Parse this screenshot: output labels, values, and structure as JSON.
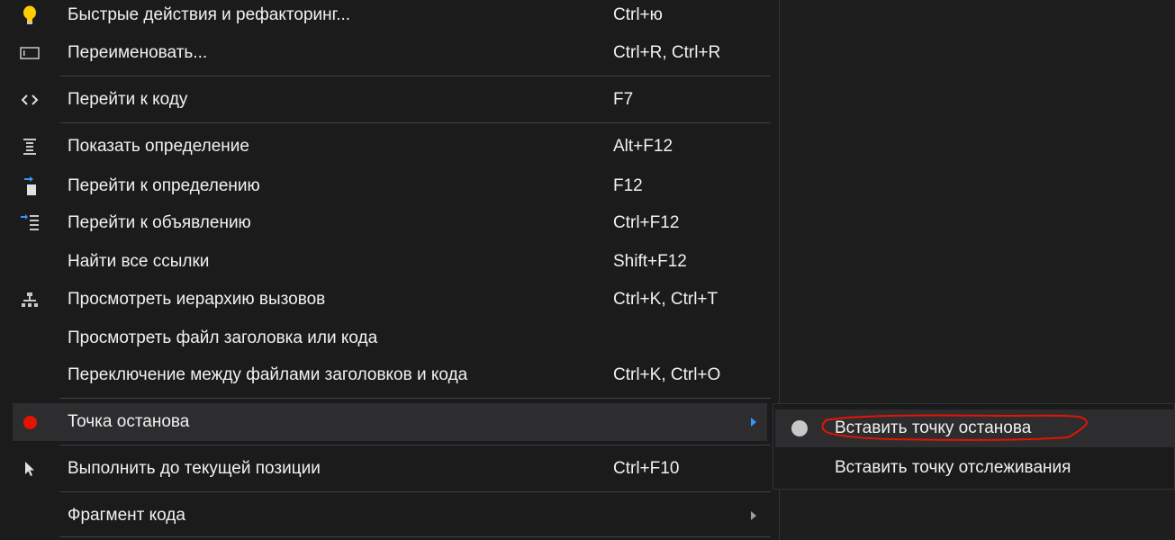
{
  "menu": {
    "items": [
      {
        "icon": "lightbulb-icon",
        "label": "Быстрые действия и рефакторинг...",
        "shortcut": "Ctrl+ю"
      },
      {
        "icon": "rename-icon",
        "label": "Переименовать...",
        "shortcut": "Ctrl+R, Ctrl+R"
      },
      {
        "icon": "code-brackets-icon",
        "label": "Перейти к коду",
        "shortcut": "F7"
      },
      {
        "icon": "peek-definition-icon",
        "label": "Показать определение",
        "shortcut": "Alt+F12"
      },
      {
        "icon": "go-to-definition-icon",
        "label": "Перейти к определению",
        "shortcut": "F12"
      },
      {
        "icon": "go-to-declaration-icon",
        "label": "Перейти к объявлению",
        "shortcut": "Ctrl+F12"
      },
      {
        "icon": "",
        "label": "Найти все ссылки",
        "shortcut": "Shift+F12"
      },
      {
        "icon": "call-hierarchy-icon",
        "label": "Просмотреть иерархию вызовов",
        "shortcut": "Ctrl+K, Ctrl+T"
      },
      {
        "icon": "",
        "label": "Просмотреть файл заголовка или кода",
        "shortcut": ""
      },
      {
        "icon": "",
        "label": "Переключение между файлами заголовков и кода",
        "shortcut": "Ctrl+K, Ctrl+O"
      },
      {
        "icon": "breakpoint-icon",
        "label": "Точка останова",
        "shortcut": "",
        "submenu": true,
        "highlighted": true
      },
      {
        "icon": "cursor-arrow-icon",
        "label": "Выполнить до текущей позиции",
        "shortcut": "Ctrl+F10"
      },
      {
        "icon": "",
        "label": "Фрагмент кода",
        "shortcut": "",
        "submenu": true
      }
    ]
  },
  "submenu": {
    "items": [
      {
        "icon": "breakpoint-gray-icon",
        "label": "Вставить точку останова",
        "highlighted": true
      },
      {
        "icon": "",
        "label": "Вставить точку отслеживания"
      }
    ]
  },
  "colors": {
    "background": "#1b1b1c",
    "highlight": "#2d2d30",
    "separator": "#3f3f46",
    "breakpoint": "#e51400",
    "submenu_arrow_active": "#3794ff",
    "annotation": "#e51400"
  }
}
